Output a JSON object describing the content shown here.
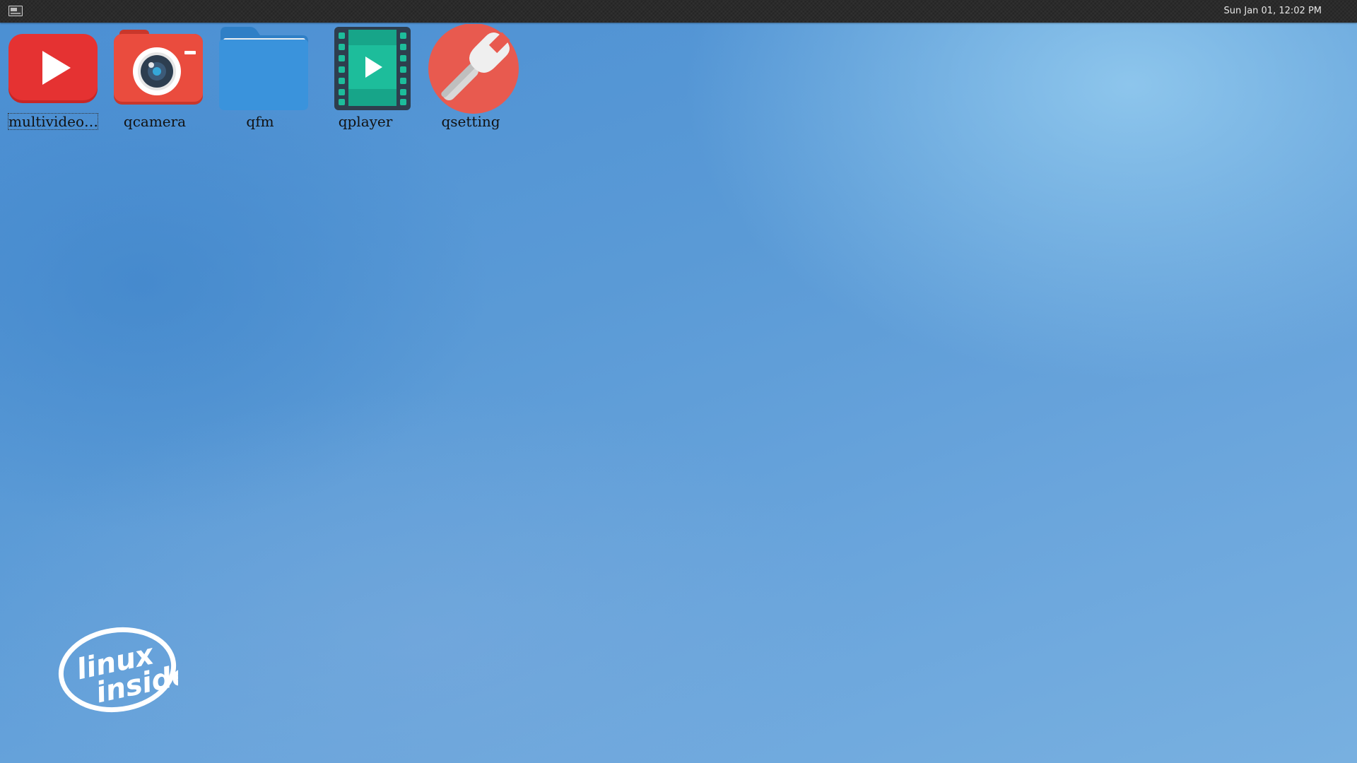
{
  "panel": {
    "menu_icon": "application-menu-icon",
    "clock": "Sun Jan 01, 12:02 PM"
  },
  "desktop": {
    "icons": [
      {
        "label": "multivideo…",
        "icon": "youtube-play-icon",
        "color": "#e03030"
      },
      {
        "label": "qcamera",
        "icon": "camera-icon",
        "color": "#e94c3d"
      },
      {
        "label": "qfm",
        "icon": "folder-icon",
        "color": "#3a93dc"
      },
      {
        "label": "qplayer",
        "icon": "film-strip-icon",
        "color": "#1dbd9b"
      },
      {
        "label": "qsetting",
        "icon": "wrench-icon",
        "color": "#e85a4f"
      }
    ]
  },
  "logo": {
    "line1": "linux",
    "line2": "inside"
  }
}
